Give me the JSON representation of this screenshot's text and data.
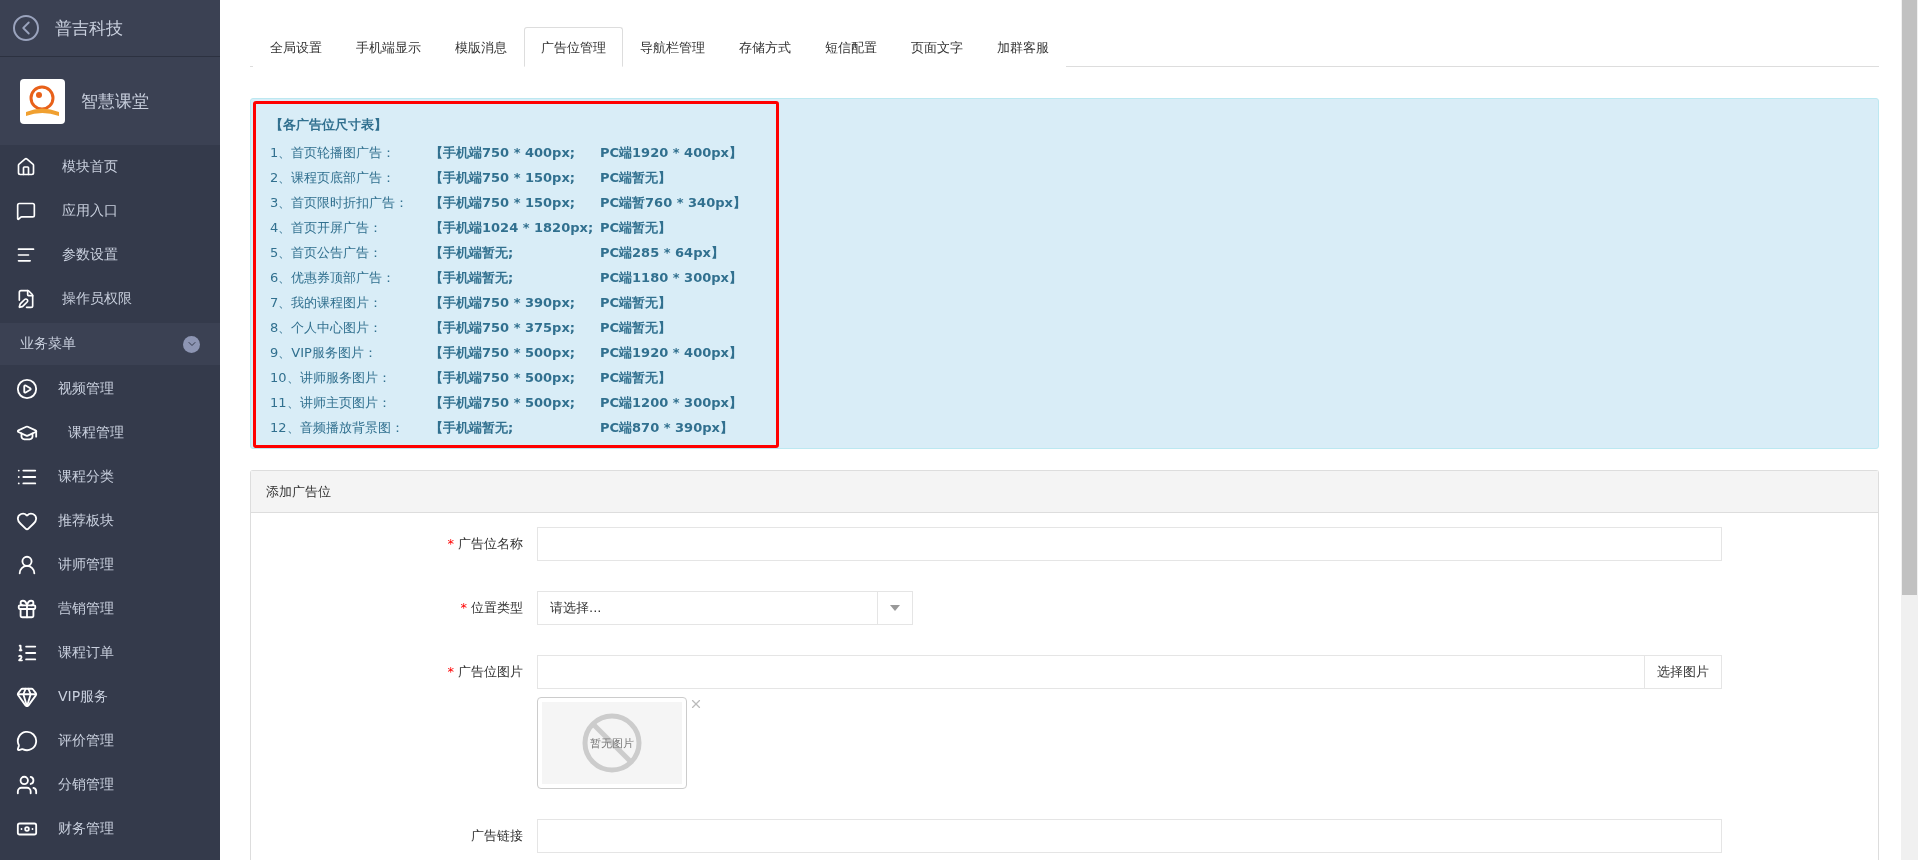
{
  "sidebar": {
    "title": "普吉科技",
    "app_name": "智慧课堂",
    "top_items": [
      {
        "label": "模块首页"
      },
      {
        "label": "应用入口"
      },
      {
        "label": "参数设置"
      },
      {
        "label": "操作员权限"
      }
    ],
    "section": {
      "label": "业务菜单",
      "expanded": true
    },
    "items": [
      {
        "label": "视频管理"
      },
      {
        "label": "课程管理"
      },
      {
        "label": "课程分类"
      },
      {
        "label": "推荐板块"
      },
      {
        "label": "讲师管理"
      },
      {
        "label": "营销管理"
      },
      {
        "label": "课程订单"
      },
      {
        "label": "VIP服务"
      },
      {
        "label": "评价管理"
      },
      {
        "label": "分销管理"
      },
      {
        "label": "财务管理"
      }
    ]
  },
  "tabs": [
    {
      "label": "全局设置",
      "selected": false
    },
    {
      "label": "手机端显示",
      "selected": false
    },
    {
      "label": "模版消息",
      "selected": false
    },
    {
      "label": "广告位管理",
      "selected": true
    },
    {
      "label": "导航栏管理",
      "selected": false
    },
    {
      "label": "存储方式",
      "selected": false
    },
    {
      "label": "短信配置",
      "selected": false
    },
    {
      "label": "页面文字",
      "selected": false
    },
    {
      "label": "加群客服",
      "selected": false
    }
  ],
  "notice": {
    "title": "【各广告位尺寸表】",
    "rows": [
      {
        "label": "1、首页轮播图广告：",
        "mobile": "【手机端750 * 400px;",
        "pc": "PC端1920 * 400px】"
      },
      {
        "label": "2、课程页底部广告：",
        "mobile": "【手机端750 * 150px;",
        "pc": "PC端暂无】"
      },
      {
        "label": "3、首页限时折扣广告：",
        "mobile": "【手机端750 * 150px;",
        "pc": "PC端暂760 * 340px】"
      },
      {
        "label": "4、首页开屏广告：",
        "mobile": "【手机端1024 * 1820px;",
        "pc": "PC端暂无】"
      },
      {
        "label": "5、首页公告广告：",
        "mobile": "【手机端暂无;",
        "pc": "PC端285 * 64px】"
      },
      {
        "label": "6、优惠券顶部广告：",
        "mobile": "【手机端暂无;",
        "pc": "PC端1180 * 300px】"
      },
      {
        "label": "7、我的课程图片：",
        "mobile": "【手机端750 * 390px;",
        "pc": "PC端暂无】"
      },
      {
        "label": "8、个人中心图片：",
        "mobile": "【手机端750 * 375px;",
        "pc": "PC端暂无】"
      },
      {
        "label": "9、VIP服务图片：",
        "mobile": "【手机端750 * 500px;",
        "pc": "PC端1920 * 400px】"
      },
      {
        "label": "10、讲师服务图片：",
        "mobile": "【手机端750 * 500px;",
        "pc": "PC端暂无】"
      },
      {
        "label": "11、讲师主页图片：",
        "mobile": "【手机端750 * 500px;",
        "pc": "PC端1200 * 300px】"
      },
      {
        "label": "12、音频播放背景图：",
        "mobile": "【手机端暂无;",
        "pc": "PC端870 * 390px】"
      }
    ]
  },
  "panel": {
    "title": "添加广告位",
    "fields": [
      {
        "kind": "text",
        "required_mark": "*",
        "label": "广告位名称"
      },
      {
        "kind": "select",
        "required_mark": "*",
        "label": "位置类型",
        "placeholder": "请选择..."
      },
      {
        "kind": "image",
        "required_mark": "*",
        "label": "广告位图片",
        "button": "选择图片",
        "preview_text": "暂无图片"
      },
      {
        "kind": "text",
        "label": "广告链接"
      }
    ]
  }
}
